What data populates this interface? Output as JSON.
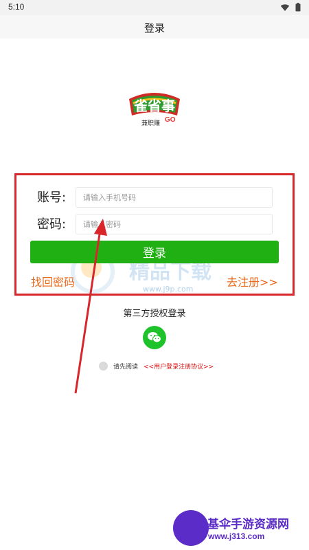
{
  "status_bar": {
    "time": "5:10"
  },
  "header": {
    "title": "登录"
  },
  "logo": {
    "name": "雀省事",
    "tagline": "兼职赚",
    "go": "GO"
  },
  "form": {
    "account_label": "账号:",
    "account_placeholder": "请输入手机号码",
    "password_label": "密码:",
    "password_placeholder": "请输入密码",
    "login_button": "登录",
    "forgot_password": "找回密码",
    "register": "去注册>>"
  },
  "third_party": {
    "title": "第三方授权登录",
    "icon": "wechat-icon"
  },
  "agreement": {
    "prefix": "请先阅读",
    "link": "<<用户登录注册协议>>"
  },
  "watermark": {
    "text": "精品下载",
    "url": "www.j9p.com"
  },
  "corner_watermark": {
    "title": "基伞手游资源网",
    "url": "www.j313.com"
  },
  "colors": {
    "login_button": "#21b014",
    "link_orange": "#e96b1e",
    "highlight_red": "#d9262b",
    "wechat_green": "#1ec22a"
  }
}
